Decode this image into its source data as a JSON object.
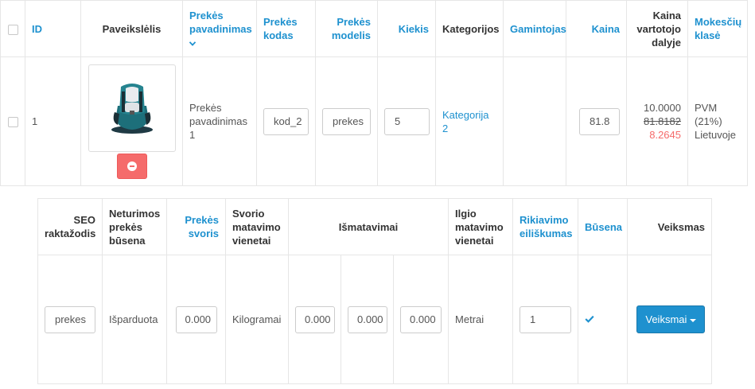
{
  "colors": {
    "link": "#1e91cf",
    "danger": "#f56b6b",
    "primary": "#1e91cf"
  },
  "top_table": {
    "headers": {
      "id": "ID",
      "image": "Paveikslėlis",
      "name": "Prekės pavadinimas",
      "code": "Prekės kodas",
      "model": "Prekės modelis",
      "quantity": "Kiekis",
      "categories": "Kategorijos",
      "manufacturer": "Gamintojas",
      "price": "Kaina",
      "consumer_price": "Kaina vartotojo dalyje",
      "tax_class": "Mokesčių klasė"
    },
    "row": {
      "id": "1",
      "image_icon": "car-seat-image",
      "name": "Prekės pavadinimas 1",
      "code_value": "kod_2",
      "model_value": "prekes",
      "quantity_value": "5",
      "category_link": "Kategorija 2",
      "manufacturer": "",
      "price_value": "81.8",
      "consumer_price_base": "10.0000",
      "consumer_price_old": "81.8182",
      "consumer_price_special": "8.2645",
      "tax_class": "PVM (21%) Lietuvoje"
    }
  },
  "bottom_table": {
    "headers": {
      "seo": "SEO raktažodis",
      "stock_status": "Neturimos prekės būsena",
      "weight": "Prekės svoris",
      "weight_unit": "Svorio matavimo vienetai",
      "dimensions": "Išmatavimai",
      "length_unit": "Ilgio matavimo vienetai",
      "sort_order": "Rikiavimo eiliškumas",
      "status": "Būsena",
      "action": "Veiksmas"
    },
    "row": {
      "seo_value": "prekes",
      "stock_status": "Išparduota",
      "weight_value": "0.000",
      "weight_unit": "Kilogramai",
      "length_value": "0.000",
      "width_value": "0.000",
      "height_value": "0.000",
      "length_unit": "Metrai",
      "sort_order_value": "1",
      "status_icon": "check-icon",
      "action_button": "Veiksmai"
    }
  }
}
